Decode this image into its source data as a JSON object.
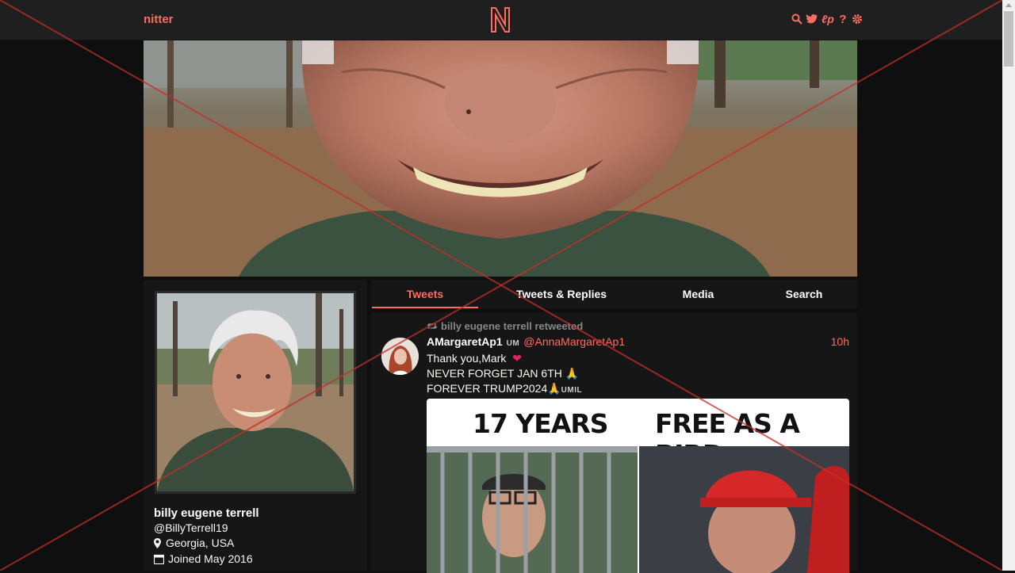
{
  "navbar": {
    "brand": "nitter",
    "logo_letter": "N",
    "icons": [
      "search-icon",
      "bird-icon",
      "rss-icon",
      "help-icon",
      "gear-icon"
    ]
  },
  "profile": {
    "fullname": "billy eugene terrell",
    "username": "@BillyTerrell19",
    "location": "Georgia, USA",
    "joined": "Joined May 2016"
  },
  "tabs": [
    {
      "label": "Tweets",
      "active": true
    },
    {
      "label": "Tweets & Replies",
      "active": false
    },
    {
      "label": "Media",
      "active": false
    },
    {
      "label": "Search",
      "active": false
    }
  ],
  "tweet": {
    "retweet_header": "billy eugene terrell retweeted",
    "fullname": "AMargaretAp1",
    "badge": "UM",
    "username": "@AnnaMargaretAp1",
    "date": "10h",
    "lines": [
      "Thank you,Mark",
      "NEVER FORGET JAN 6TH 🙏",
      "FOREVER TRUMP2024🙏"
    ],
    "line3_badge": "UMIL",
    "media_caption_left": "17 YEARS",
    "media_caption_right": "FREE AS A BIRD"
  },
  "colors": {
    "accent": "#ff6c60",
    "background": "#0f0f0f",
    "panel": "#161616",
    "navbar": "#1f1f1f",
    "overlay_cross": "#c0302a"
  }
}
